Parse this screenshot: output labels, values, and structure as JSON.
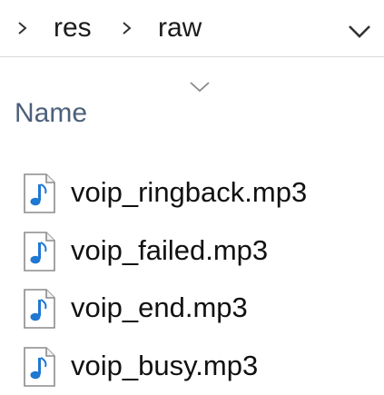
{
  "breadcrumb": {
    "items": [
      "res",
      "raw"
    ]
  },
  "file_list": {
    "column_header": "Name",
    "files": [
      {
        "name": "voip_ringback.mp3",
        "icon": "audio-file-icon"
      },
      {
        "name": "voip_failed.mp3",
        "icon": "audio-file-icon"
      },
      {
        "name": "voip_end.mp3",
        "icon": "audio-file-icon"
      },
      {
        "name": "voip_busy.mp3",
        "icon": "audio-file-icon"
      }
    ]
  },
  "colors": {
    "column_header_text": "#4c607a",
    "music_note_accent": "#1f78d1"
  }
}
